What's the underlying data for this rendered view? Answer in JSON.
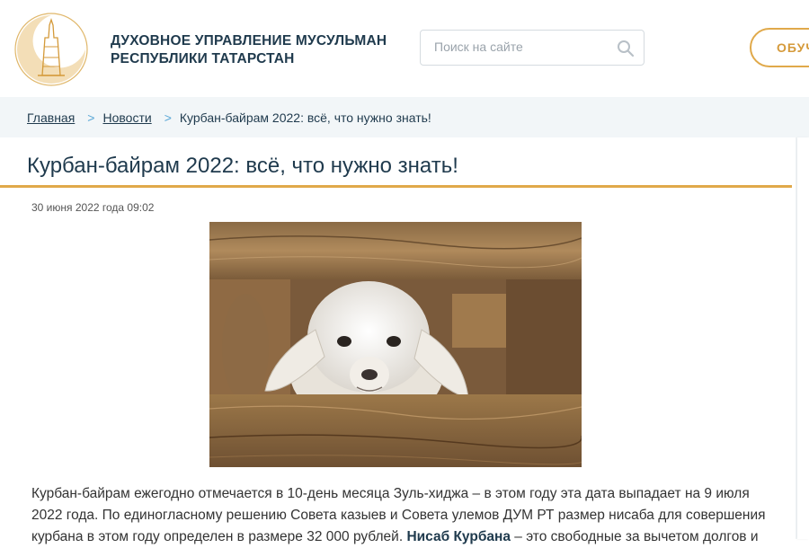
{
  "header": {
    "org_line1": "ДУХОВНОЕ УПРАВЛЕНИЕ МУСУЛЬМАН",
    "org_line2": "РЕСПУБЛИКИ ТАТАРСТАН",
    "search_placeholder": "Поиск на сайте",
    "search_icon": "search-icon",
    "edu_button_label": "ОБУЧ",
    "logo_icon": "crescent-minaret-logo"
  },
  "breadcrumb": {
    "home": "Главная",
    "news": "Новости",
    "current": "Курбан-байрам 2022: всё, что нужно знать!",
    "separator": ">"
  },
  "article": {
    "title": "Курбан-байрам 2022: всё, что нужно знать!",
    "date": "30 июня 2022 года 09:02",
    "image_subject": "lamb-photo",
    "p1_text": "Курбан-байрам ежегодно отмечается в 10-день месяца Зуль-хиджа – в этом году эта дата выпадает на 9 июля 2022 года. По единогласному решению Совета казыев и Совета улемов ДУМ РТ размер нисаба для совершения курбана в этом году определен в размере 32 000 рублей. ",
    "p1_bold": "Нисаб Курбана",
    "p1_tail": " – это свободные за вычетом долгов и"
  },
  "colors": {
    "accent": "#e0a94a",
    "heading": "#1f3a4d",
    "separator": "#5aa7d6",
    "page_bg": "#f2f6f8"
  }
}
